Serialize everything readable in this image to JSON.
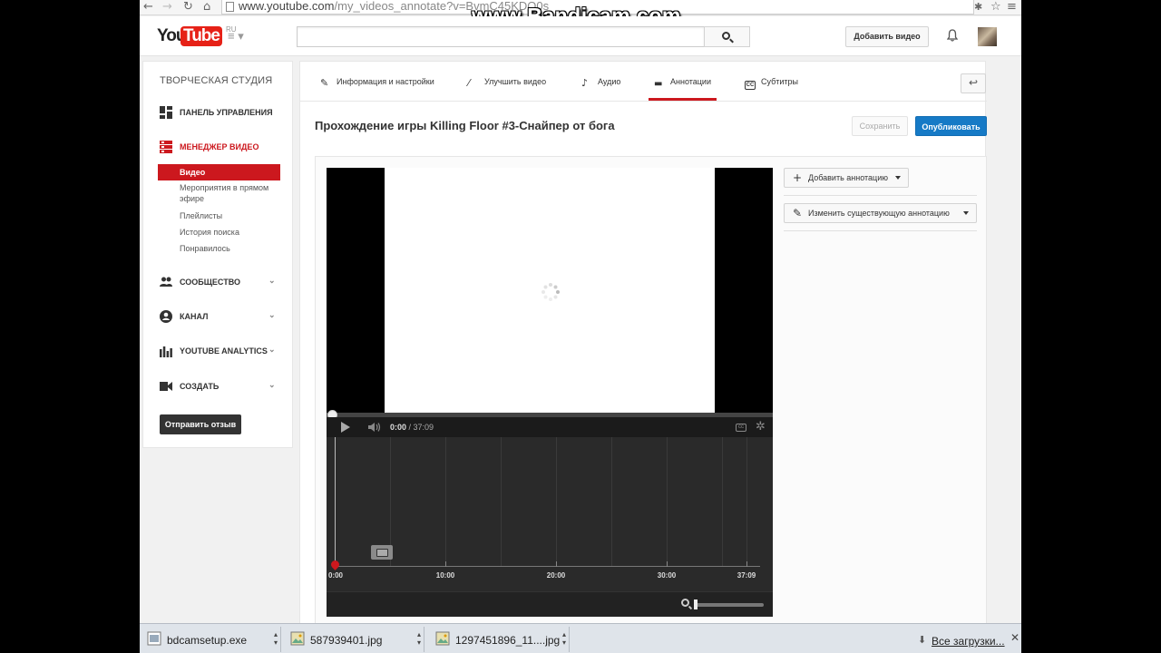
{
  "browser": {
    "url_host": "www.youtube.com",
    "url_path": "/my_videos_annotate?v=BvmC45KDQ0s",
    "watermark": "www.Bandicam.com"
  },
  "header": {
    "logo_you": "You",
    "logo_tube": "Tube",
    "logo_region": "RU",
    "search_placeholder": "",
    "upload_label": "Добавить видео"
  },
  "sidebar": {
    "studio_title": "ТВОРЧЕСКАЯ СТУДИЯ",
    "dashboard": "ПАНЕЛЬ УПРАВЛЕНИЯ",
    "video_manager": "МЕНЕДЖЕР ВИДЕО",
    "video_manager_items": [
      "Видео",
      "Мероприятия в прямом эфире",
      "Плейлисты",
      "История поиска",
      "Понравилось"
    ],
    "community": "СООБЩЕСТВО",
    "channel": "КАНАЛ",
    "analytics": "YOUTUBE ANALYTICS",
    "create": "СОЗДАТЬ",
    "feedback_label": "Отправить отзыв"
  },
  "tabs": [
    {
      "label": "Информация и настройки",
      "icon": "pencil-icon"
    },
    {
      "label": "Улучшить видео",
      "icon": "magic-wand-icon"
    },
    {
      "label": "Аудио",
      "icon": "music-note-icon"
    },
    {
      "label": "Аннотации",
      "icon": "speech-bubble-icon",
      "active": true
    },
    {
      "label": "Субтитры",
      "icon": "cc-icon"
    }
  ],
  "main": {
    "video_title": "Прохождение игры Killing Floor #3-Снайпер от бога",
    "save_label": "Сохранить",
    "publish_label": "Опубликовать"
  },
  "player": {
    "current_time": "0:00",
    "duration": "/ 37:09"
  },
  "timeline": {
    "labels": [
      "0:00",
      "10:00",
      "20:00",
      "30:00",
      "37:09"
    ]
  },
  "annotations": {
    "add_label": "Добавить аннотацию",
    "edit_label": "Изменить существующую аннотацию"
  },
  "downloads": {
    "items": [
      "bdcamsetup.exe",
      "587939401.jpg",
      "1297451896_11....jpg"
    ],
    "all_label": "Все загрузки..."
  },
  "colors": {
    "accent_red": "#cc181e",
    "publish_blue": "#167ac6"
  }
}
